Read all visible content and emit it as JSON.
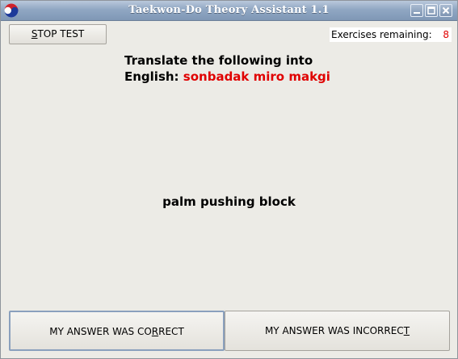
{
  "window": {
    "title": "Taekwon-Do Theory Assistant 1.1"
  },
  "controls": {
    "minimize": "minimize",
    "maximize": "maximize",
    "close": "close"
  },
  "toolbar": {
    "stop_prefix": "",
    "stop_mnemonic": "S",
    "stop_rest": "TOP TEST"
  },
  "status": {
    "remaining_label": "Exercises remaining:",
    "remaining_count": "8"
  },
  "question": {
    "line1": "Translate the following into",
    "line2_prefix": "English:",
    "term": "sonbadak miro makgi"
  },
  "answer": {
    "text": "palm pushing block"
  },
  "buttons": {
    "correct_prefix": "MY ANSWER WAS CO",
    "correct_mnemonic": "R",
    "correct_rest": "RECT",
    "incorrect_prefix": "MY ANSWER WAS INCORREC",
    "incorrect_mnemonic": "T",
    "incorrect_rest": ""
  },
  "colors": {
    "accent_red": "#e00000",
    "titlebar": "#90a7c3",
    "background": "#ecebe6"
  }
}
